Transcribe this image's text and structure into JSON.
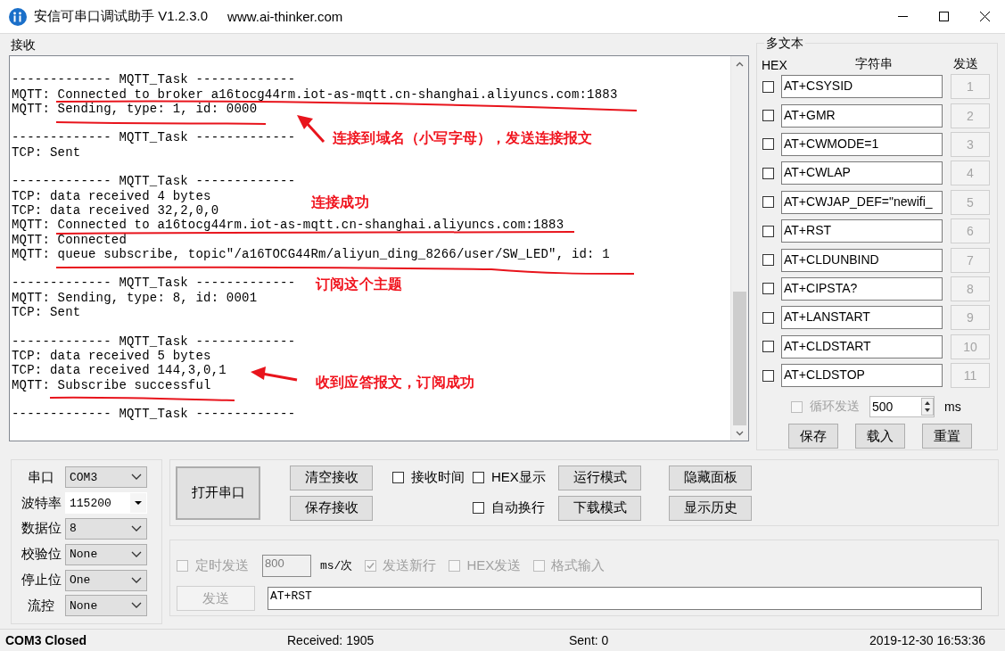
{
  "window": {
    "title": "安信可串口调试助手 V1.2.3.0",
    "website": "www.ai-thinker.com"
  },
  "receive": {
    "label": "接收",
    "blocks": [
      {
        "lines": [
          "------------- MQTT_Task -------------",
          "MQTT: Connected to broker a16tocg44rm.iot-as-mqtt.cn-shanghai.aliyuncs.com:1883",
          "MQTT: Sending, type: 1, id: 0000"
        ]
      },
      {
        "lines": [
          "------------- MQTT_Task -------------",
          "TCP: Sent"
        ]
      },
      {
        "lines": [
          "------------- MQTT_Task -------------",
          "TCP: data received 4 bytes",
          "TCP: data received 32,2,0,0",
          "MQTT: Connected to a16tocg44rm.iot-as-mqtt.cn-shanghai.aliyuncs.com:1883",
          "MQTT: Connected",
          "MQTT: queue subscribe, topic\"/a16TOCG44Rm/aliyun_ding_8266/user/SW_LED\", id: 1"
        ]
      },
      {
        "lines": [
          "------------- MQTT_Task -------------",
          "MQTT: Sending, type: 8, id: 0001",
          "TCP: Sent"
        ]
      },
      {
        "lines": [
          "------------- MQTT_Task -------------",
          "TCP: data received 5 bytes",
          "TCP: data received 144,3,0,1",
          "MQTT: Subscribe successful"
        ]
      },
      {
        "lines": [
          "------------- MQTT_Task -------------"
        ]
      }
    ]
  },
  "annotations": [
    {
      "text": "连接到域名（小写字母），发送连接报文"
    },
    {
      "text": "连接成功"
    },
    {
      "text": "订阅这个主题"
    },
    {
      "text": "收到应答报文，订阅成功"
    }
  ],
  "multi_text": {
    "title": "多文本",
    "headers": {
      "hex": "HEX",
      "string": "字符串",
      "send": "发送"
    },
    "rows": [
      {
        "hex": false,
        "value": "AT+CSYSID",
        "button": "1"
      },
      {
        "hex": false,
        "value": "AT+GMR",
        "button": "2"
      },
      {
        "hex": false,
        "value": "AT+CWMODE=1",
        "button": "3"
      },
      {
        "hex": false,
        "value": "AT+CWLAP",
        "button": "4"
      },
      {
        "hex": false,
        "value": "AT+CWJAP_DEF=\"newifi_",
        "button": "5"
      },
      {
        "hex": false,
        "value": "AT+RST",
        "button": "6"
      },
      {
        "hex": false,
        "value": "AT+CLDUNBIND",
        "button": "7"
      },
      {
        "hex": false,
        "value": "AT+CIPSTA?",
        "button": "8"
      },
      {
        "hex": false,
        "value": "AT+LANSTART",
        "button": "9"
      },
      {
        "hex": false,
        "value": "AT+CLDSTART",
        "button": "10"
      },
      {
        "hex": false,
        "value": "AT+CLDSTOP",
        "button": "11"
      }
    ],
    "loop": {
      "label": "循环发送",
      "checked": false,
      "disabled": true,
      "interval": "500",
      "unit": "ms"
    },
    "buttons": [
      "保存",
      "载入",
      "重置"
    ]
  },
  "port_settings": [
    {
      "label": "串口",
      "value": "COM3",
      "kind": "select"
    },
    {
      "label": "波特率",
      "value": "115200",
      "kind": "combo"
    },
    {
      "label": "数据位",
      "value": "8",
      "kind": "select"
    },
    {
      "label": "校验位",
      "value": "None",
      "kind": "select"
    },
    {
      "label": "停止位",
      "value": "One",
      "kind": "select"
    },
    {
      "label": "流控",
      "value": "None",
      "kind": "select"
    }
  ],
  "controls": {
    "open_button": "打开串口",
    "receive_buttons": [
      "清空接收",
      "保存接收"
    ],
    "options": [
      {
        "label": "接收时间",
        "checked": false
      },
      {
        "label": "HEX显示",
        "checked": false
      },
      {
        "label": "自动换行",
        "checked": false
      }
    ],
    "mode_buttons": [
      "运行模式",
      "下载模式"
    ],
    "panel_buttons": [
      "隐藏面板",
      "显示历史"
    ]
  },
  "send": {
    "timed": {
      "label": "定时发送",
      "checked": false,
      "disabled": true
    },
    "interval": "800",
    "interval_unit": "ms/次",
    "options": [
      {
        "label": "发送新行",
        "checked": true,
        "disabled": true
      },
      {
        "label": "HEX发送",
        "checked": false,
        "disabled": true
      },
      {
        "label": "格式输入",
        "checked": false,
        "disabled": true
      }
    ],
    "send_button": {
      "label": "发送",
      "disabled": true
    },
    "input": "AT+RST"
  },
  "status_bar": {
    "port": "COM3 Closed",
    "received": "Received: 1905",
    "sent": "Sent: 0",
    "time": "2019-12-30 16:53:36"
  }
}
